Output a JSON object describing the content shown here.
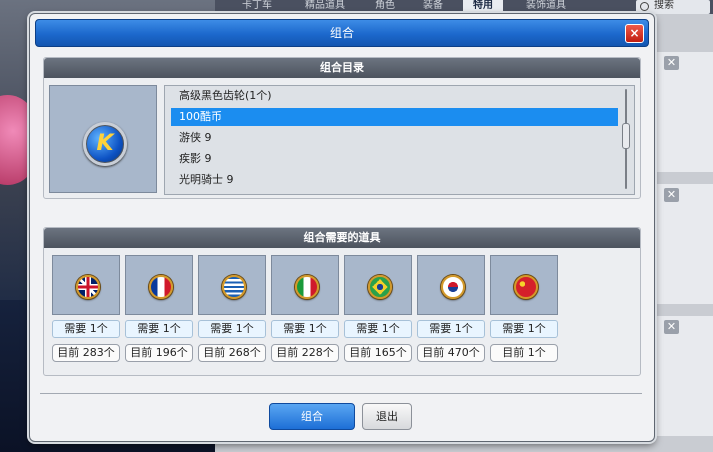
{
  "background": {
    "tabs": [
      "卡丁车",
      "精品道具",
      "角色",
      "装备",
      "特用",
      "装饰道具"
    ],
    "active_tab": "特用",
    "search_label": "搜索"
  },
  "dialog": {
    "title": "组合",
    "catalog_header": "组合目录",
    "catalog_items": [
      {
        "label": "高级黑色齿轮(1个)",
        "selected": false
      },
      {
        "label": "100酷币",
        "selected": true
      },
      {
        "label": "游侠 9",
        "selected": false
      },
      {
        "label": "疾影 9",
        "selected": false
      },
      {
        "label": "光明骑士 9",
        "selected": false
      }
    ],
    "preview_icon_letter": "K",
    "required_header": "组合需要的道具",
    "required_items": [
      {
        "flag": "uk-flag-icon",
        "need": "需要 1个",
        "current": "目前 283个"
      },
      {
        "flag": "france-flag-icon",
        "need": "需要 1个",
        "current": "目前 196个"
      },
      {
        "flag": "greece-flag-icon",
        "need": "需要 1个",
        "current": "目前 268个"
      },
      {
        "flag": "italy-flag-icon",
        "need": "需要 1个",
        "current": "目前 228个"
      },
      {
        "flag": "brazil-flag-icon",
        "need": "需要 1个",
        "current": "目前 165个"
      },
      {
        "flag": "korea-flag-icon",
        "need": "需要 1个",
        "current": "目前 470个"
      },
      {
        "flag": "china-flag-icon",
        "need": "需要 1个",
        "current": "目前 1个"
      }
    ],
    "combine_button": "组合",
    "exit_button": "退出",
    "close_button": "×"
  }
}
